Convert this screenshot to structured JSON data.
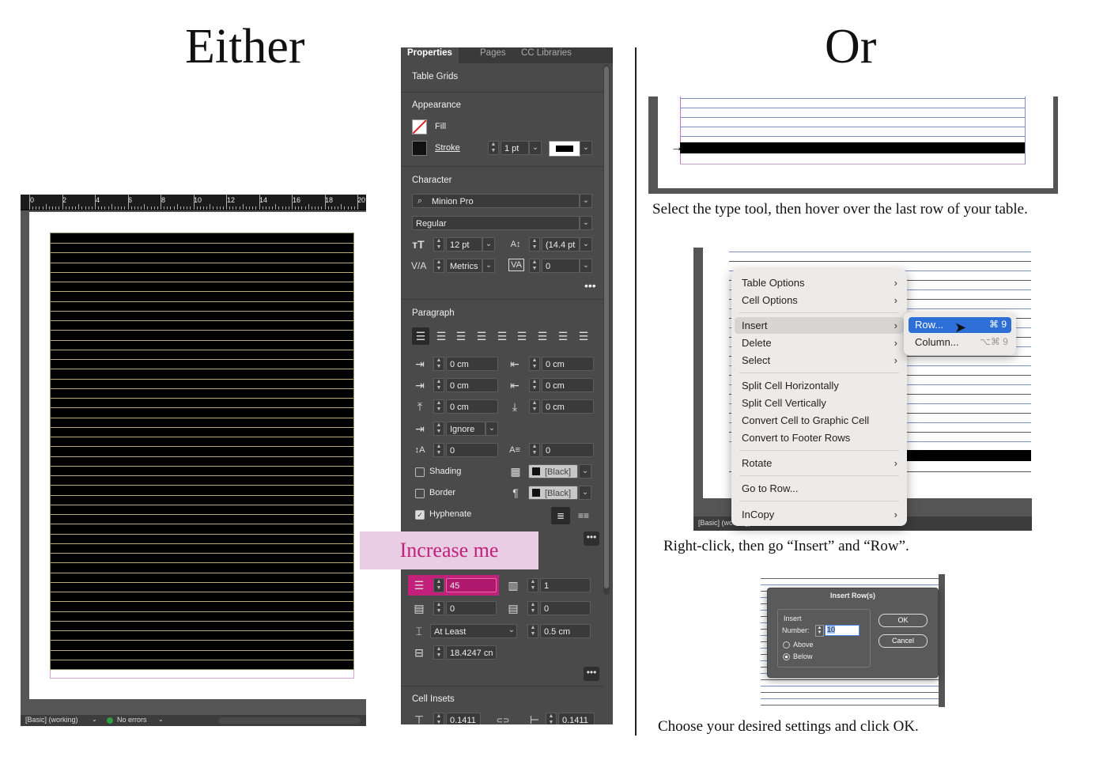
{
  "headings": {
    "left": "Either",
    "right": "Or"
  },
  "document": {
    "ruler_numbers": [
      "0",
      "2",
      "4",
      "6",
      "8",
      "10",
      "12",
      "14",
      "16",
      "18",
      "20"
    ],
    "status_mode": "[Basic] (working)",
    "status_errors": "No errors",
    "status_ok_color": "#2ea043"
  },
  "panel": {
    "tabs": [
      "Properties",
      "Pages",
      "CC Libraries"
    ],
    "table_grids_title": "Table Grids",
    "appearance_title": "Appearance",
    "fill_label": "Fill",
    "stroke_label": "Stroke",
    "stroke_weight": "1 pt",
    "character_title": "Character",
    "font_family": "Minion Pro",
    "font_style": "Regular",
    "font_size": "12 pt",
    "leading": "(14.4 pt",
    "kerning": "Metrics",
    "tracking": "0",
    "paragraph_title": "Paragraph",
    "indent_left": "0 cm",
    "indent_right": "0 cm",
    "first_line_indent": "0 cm",
    "last_line_indent": "0 cm",
    "space_before": "0 cm",
    "space_after": "0 cm",
    "align_to_grid": "Ignore",
    "drop_cap_lines": "0",
    "drop_cap_chars": "0",
    "shading_label": "Shading",
    "shading_color": "[Black]",
    "border_label": "Border",
    "border_color": "[Black]",
    "hyphenate_label": "Hyphenate",
    "hyphenate_checked": true,
    "rows": "45",
    "columns": "1",
    "header_rows": "0",
    "footer_rows": "0",
    "row_height_mode": "At Least",
    "row_height": "0.5 cm",
    "column_width": "18.4247 cn",
    "cell_insets_title": "Cell Insets",
    "inset_top": "0.1411",
    "inset_left": "0.1411",
    "highlight_color": "#c2207a"
  },
  "callout": {
    "text": "Increase me"
  },
  "step1": {
    "caption": "Select the type tool, then hover over the last row of your table."
  },
  "step2": {
    "menu_items": {
      "table_options": "Table Options",
      "cell_options": "Cell Options",
      "insert": "Insert",
      "delete": "Delete",
      "select": "Select",
      "split_h": "Split Cell Horizontally",
      "split_v": "Split Cell Vertically",
      "convert_graphic": "Convert Cell to Graphic Cell",
      "convert_footer": "Convert to Footer Rows",
      "rotate": "Rotate",
      "go_to_row": "Go to Row...",
      "incopy": "InCopy"
    },
    "submenu": {
      "row": "Row...",
      "row_shortcut": "⌘ 9",
      "column": "Column...",
      "column_shortcut": "⌥⌘ 9"
    },
    "status_mode": "[Basic] (working)",
    "caption": "Right-click, then go “Insert” and “Row”."
  },
  "step3": {
    "dialog_title": "Insert Row(s)",
    "group_label": "Insert",
    "number_label": "Number:",
    "number_value": "10",
    "above_label": "Above",
    "below_label": "Below",
    "selected_position": "Below",
    "ok_label": "OK",
    "cancel_label": "Cancel",
    "caption": "Choose your desired settings and click OK."
  }
}
